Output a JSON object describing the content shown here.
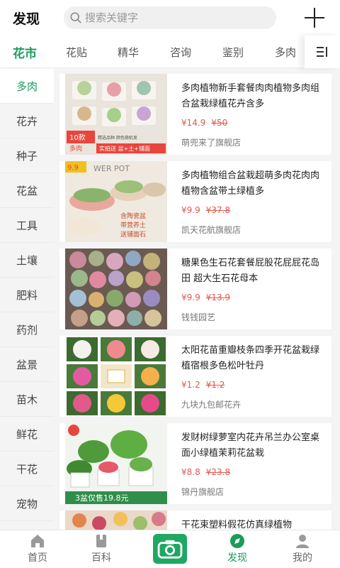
{
  "header": {
    "title": "发现",
    "search_placeholder": "搜索关键字"
  },
  "tabs": [
    {
      "label": "花市",
      "active": true
    },
    {
      "label": "花贴"
    },
    {
      "label": "精华"
    },
    {
      "label": "咨询"
    },
    {
      "label": "鉴别"
    },
    {
      "label": "多肉"
    }
  ],
  "sidebar": [
    {
      "label": "多肉",
      "active": true
    },
    {
      "label": "花卉"
    },
    {
      "label": "种子"
    },
    {
      "label": "花盆"
    },
    {
      "label": "工具"
    },
    {
      "label": "土壤"
    },
    {
      "label": "肥料"
    },
    {
      "label": "药剂"
    },
    {
      "label": "盆景"
    },
    {
      "label": "苗木"
    },
    {
      "label": "鲜花"
    },
    {
      "label": "干花"
    },
    {
      "label": "宠物"
    }
  ],
  "products": [
    {
      "name": "多肉植物新手套餐肉肉植物多肉组合盆栽绿植花卉含多",
      "price": "¥14.9",
      "original_price": "¥50",
      "shop": "萌兜来了旗舰店",
      "image_text": [
        "10款",
        "多肉",
        "精选品种 颜色随机发",
        "实拍送 盆+土+铺面"
      ]
    },
    {
      "name": "多肉植物组合盆栽超萌多肉花肉肉植物含盆带土绿植多",
      "price": "¥9.9",
      "original_price": "¥37.8",
      "shop": "凯天花航旗舰店",
      "image_text": [
        "9.9",
        "WER POT",
        "含陶瓷盆",
        "带营养土",
        "送铺面石"
      ]
    },
    {
      "name": "糖果色生石花套餐屁股花屁屁花岛田 超大生石花母本",
      "price": "¥9.9",
      "original_price": "¥13.9",
      "shop": "钱钱园艺"
    },
    {
      "name": "太阳花苗重瓣枝条四季开花盆栽绿植宿根多色松叶牡丹",
      "price": "¥1.2",
      "original_price": "¥1.2",
      "shop": "九块九包邮花卉"
    },
    {
      "name": "发财树绿萝室内花卉吊兰办公室桌面小绿植茉莉花盆栽",
      "price": "¥8.8",
      "original_price": "¥23.8",
      "shop": "锦丹旗舰店",
      "image_text": [
        "3盆仅售19.8元"
      ]
    },
    {
      "name": "干花束塑料假花仿真绿植物",
      "price": "",
      "original_price": "",
      "shop": ""
    }
  ],
  "bottom_nav": [
    {
      "label": "首页",
      "icon": "home-icon"
    },
    {
      "label": "百科",
      "icon": "book-icon"
    },
    {
      "label": "",
      "icon": "camera-icon"
    },
    {
      "label": "发现",
      "icon": "compass-icon",
      "active": true
    },
    {
      "label": "我的",
      "icon": "user-icon"
    }
  ],
  "colors": {
    "accent": "#1c9b5b",
    "price": "#e05a4f",
    "camera_bg": "#1ea861"
  }
}
